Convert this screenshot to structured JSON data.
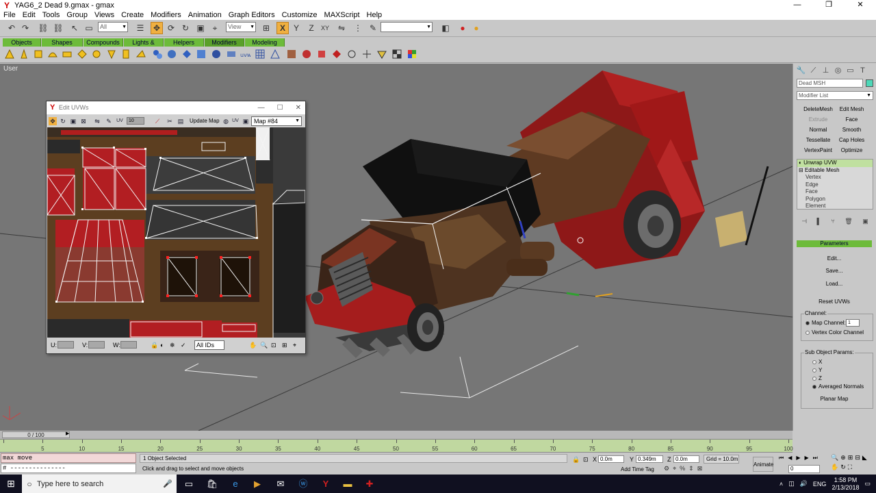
{
  "window": {
    "title": "YAG6_2 Dead 9.gmax - gmax",
    "controls": {
      "minimize": "—",
      "maximize": "❐",
      "close": "✕"
    }
  },
  "menu": [
    "File",
    "Edit",
    "Tools",
    "Group",
    "Views",
    "Create",
    "Modifiers",
    "Animation",
    "Graph Editors",
    "Customize",
    "MAXScript",
    "Help"
  ],
  "toolbar": {
    "selection_filter": "All",
    "ref_coord": "View",
    "axis_labels": {
      "x": "X",
      "y": "Y",
      "z": "Z",
      "xy": "XY"
    }
  },
  "tabs": [
    "Objects",
    "Shapes",
    "Compounds",
    "Lights & Cameras",
    "Helpers",
    "Modifiers",
    "Modeling"
  ],
  "viewport": {
    "label": "User"
  },
  "uvw_editor": {
    "title": "Edit UVWs",
    "update_map": "Update Map",
    "uv_toggle": "UV",
    "map": "Map #84",
    "u_label": "U:",
    "v_label": "V:",
    "w_label": "W:",
    "ids": "All IDs",
    "tile_value": "10"
  },
  "command_panel": {
    "object_name": "Dead MSH",
    "modifier_list": "Modifier List",
    "mod_buttons": [
      {
        "label": "DeleteMesh",
        "enabled": true
      },
      {
        "label": "Edit Mesh",
        "enabled": true
      },
      {
        "label": "Extrude",
        "enabled": false
      },
      {
        "label": "Face Extrude",
        "enabled": true
      },
      {
        "label": "Normal",
        "enabled": true
      },
      {
        "label": "Smooth",
        "enabled": true
      },
      {
        "label": "Tessellate",
        "enabled": true
      },
      {
        "label": "Cap Holes",
        "enabled": true
      },
      {
        "label": "VertexPaint",
        "enabled": true
      },
      {
        "label": "Optimize",
        "enabled": true
      }
    ],
    "stack": [
      "Unwrap UVW",
      "Editable Mesh",
      "Vertex",
      "Edge",
      "Face",
      "Polygon",
      "Element"
    ],
    "parameters_header": "Parameters",
    "param_buttons": [
      "Edit...",
      "Save...",
      "Load...",
      "Reset UVWs"
    ],
    "channel_label": "Channel:",
    "map_channel": "Map Channel:",
    "map_channel_value": "1",
    "vertex_color_channel": "Vertex Color Channel",
    "subobj_label": "Sub Object Params:",
    "axes": [
      "X",
      "Y",
      "Z",
      "Averaged Normals"
    ],
    "planar_map": "Planar Map"
  },
  "timeline": {
    "frame_display": "0 / 100",
    "ticks": [
      "0",
      "5",
      "10",
      "15",
      "20",
      "25",
      "30",
      "35",
      "40",
      "45",
      "50",
      "55",
      "60",
      "65",
      "70",
      "75",
      "80",
      "85",
      "90",
      "95",
      "100"
    ]
  },
  "status": {
    "listener_line": "max move",
    "listener_input": "# ---------------",
    "selection": "1 Object Selected",
    "hint": "Click and drag to select and move objects",
    "x_label": "X",
    "x_value": "0.0m",
    "y_label": "Y",
    "y_value": "0.349m",
    "z_label": "Z",
    "z_value": "0.0m",
    "grid": "Grid = 10.0m",
    "add_time_tag": "Add Time Tag",
    "animate": "Animate",
    "current_frame": "0"
  },
  "taskbar": {
    "search_placeholder": "Type here to search",
    "lang": "ENG",
    "time": "1:58 PM",
    "date": "2/13/2018"
  }
}
